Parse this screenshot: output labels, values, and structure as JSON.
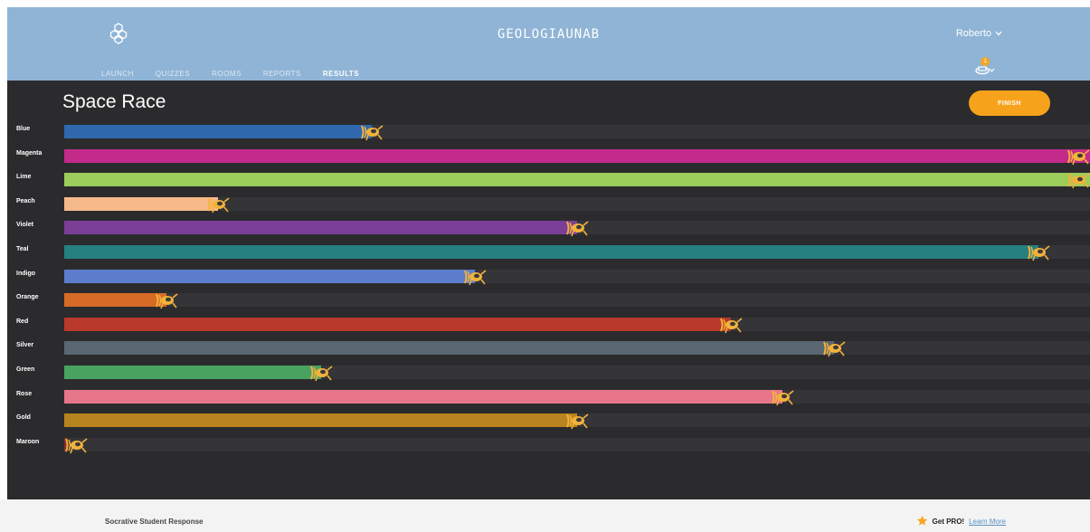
{
  "header": {
    "app_title": "GEOLOGIAUNAB",
    "user_name": "Roberto",
    "notification_count": "1",
    "logo_icon": "hexagon-cluster-icon",
    "nav_tabs": [
      {
        "label": "LAUNCH",
        "active": false
      },
      {
        "label": "QUIZZES",
        "active": false
      },
      {
        "label": "ROOMS",
        "active": false
      },
      {
        "label": "REPORTS",
        "active": false
      },
      {
        "label": "RESULTS",
        "active": true
      }
    ]
  },
  "main": {
    "title": "Space Race",
    "finish_label": "FINISH",
    "rocket_icon": "rocket-icon",
    "teams": [
      {
        "name": "Blue",
        "color": "#2f68ad",
        "progress": 0.3
      },
      {
        "name": "Magenta",
        "color": "#c42a8a",
        "progress": 1.0
      },
      {
        "name": "Lime",
        "color": "#9ccc5a",
        "progress": 1.0
      },
      {
        "name": "Peach",
        "color": "#f6b98a",
        "progress": 0.15
      },
      {
        "name": "Violet",
        "color": "#7b3f98",
        "progress": 0.5
      },
      {
        "name": "Teal",
        "color": "#268080",
        "progress": 0.95
      },
      {
        "name": "Indigo",
        "color": "#5c7dcc",
        "progress": 0.4
      },
      {
        "name": "Orange",
        "color": "#d76b26",
        "progress": 0.1
      },
      {
        "name": "Red",
        "color": "#b8392a",
        "progress": 0.65
      },
      {
        "name": "Silver",
        "color": "#5a6670",
        "progress": 0.75
      },
      {
        "name": "Green",
        "color": "#4aa261",
        "progress": 0.25
      },
      {
        "name": "Rose",
        "color": "#e8768a",
        "progress": 0.7
      },
      {
        "name": "Gold",
        "color": "#b8841f",
        "progress": 0.5
      },
      {
        "name": "Maroon",
        "color": "#8a2a2a",
        "progress": 0.0
      }
    ]
  },
  "footer": {
    "left_text": "Socrative Student Response",
    "pro_label": "Get PRO!",
    "learn_more": "Learn More"
  }
}
